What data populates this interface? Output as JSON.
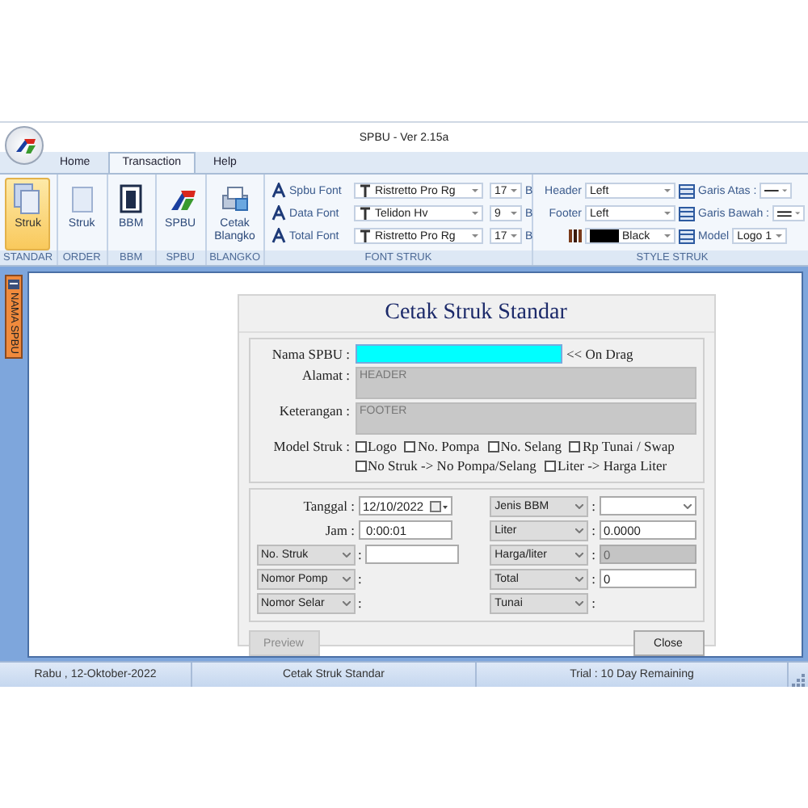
{
  "window": {
    "title": "SPBU - Ver 2.15a"
  },
  "tabs": [
    {
      "label": "Home",
      "selected": false
    },
    {
      "label": "Transaction",
      "selected": true
    },
    {
      "label": "Help",
      "selected": false
    }
  ],
  "ribbon": {
    "groups": [
      {
        "label": "STANDAR",
        "button": {
          "label": "Struk",
          "selected": true
        }
      },
      {
        "label": "ORDER",
        "button": {
          "label": "Struk",
          "selected": false
        }
      },
      {
        "label": "BBM",
        "button": {
          "label": "BBM",
          "selected": false
        }
      },
      {
        "label": "SPBU",
        "button": {
          "label": "SPBU",
          "selected": false
        }
      },
      {
        "label": "BLANGKO",
        "button": {
          "label": "Cetak Blangko",
          "selected": false
        }
      }
    ],
    "font_struk": {
      "label": "FONT STRUK",
      "rows": [
        {
          "label": "Spbu Font",
          "font": "Ristretto Pro Rg",
          "size": "17",
          "style": "B"
        },
        {
          "label": "Data Font",
          "font": "Telidon Hv",
          "size": "9",
          "style": "B"
        },
        {
          "label": "Total Font",
          "font": "Ristretto Pro Rg",
          "size": "17",
          "style": "B"
        }
      ]
    },
    "style_struk": {
      "label": "STYLE STRUK",
      "rows": [
        {
          "label": "Header",
          "value": "Left",
          "option": "Garis Atas :"
        },
        {
          "label": "Footer",
          "value": "Left",
          "option": "Garis Bawah :"
        },
        {
          "value": "Black",
          "color": "#000000",
          "option": "Model",
          "option_value": "Logo 1"
        }
      ]
    }
  },
  "side_tab": {
    "label": "NAMA SPBU"
  },
  "dialog": {
    "title": "Cetak Struk Standar",
    "nama_spbu": {
      "label": "Nama SPBU :",
      "note": "<< On Drag"
    },
    "alamat": {
      "label": "Alamat :",
      "placeholder": "HEADER"
    },
    "keterangan": {
      "label": "Keterangan :",
      "placeholder": "FOOTER"
    },
    "model_struk": {
      "label": "Model Struk :",
      "options": [
        {
          "label": "Logo",
          "checked": false
        },
        {
          "label": "No. Pompa",
          "checked": false
        },
        {
          "label": "No. Selang",
          "checked": false
        },
        {
          "label": "Rp Tunai / Swap",
          "checked": false
        },
        {
          "label": "No Struk -> No Pompa/Selang",
          "checked": false
        },
        {
          "label": "Liter -> Harga Liter",
          "checked": false
        }
      ]
    },
    "left_fields": [
      {
        "kind": "date",
        "label": "Tanggal :",
        "value": "12/10/2022"
      },
      {
        "kind": "text",
        "label": "Jam :",
        "value": "0:00:01"
      },
      {
        "kind": "select_text",
        "label": "No. Struk",
        "sep": ":"
      },
      {
        "kind": "select_only",
        "label": "Nomor Pomp",
        "sep": ":"
      },
      {
        "kind": "select_only",
        "label": "Nomor Selar",
        "sep": ":"
      }
    ],
    "right_fields": [
      {
        "kind": "select_combo",
        "label": "Jenis BBM",
        "sep": ":"
      },
      {
        "kind": "select_text",
        "label": "Liter",
        "sep": ":",
        "value": "0.0000",
        "disabled": false
      },
      {
        "kind": "select_text",
        "label": "Harga/liter",
        "sep": ":",
        "value": "0",
        "disabled": true
      },
      {
        "kind": "select_text",
        "label": "Total",
        "sep": ":",
        "value": "0",
        "disabled": false
      },
      {
        "kind": "select_only",
        "label": "Tunai",
        "sep": ":"
      }
    ],
    "buttons": [
      {
        "label": "Preview",
        "disabled": true
      },
      {
        "label": "Close",
        "disabled": false
      }
    ]
  },
  "status_bar": [
    "Rabu , 12-Oktober-2022",
    "Cetak Struk Standar",
    "Trial : 10 Day Remaining"
  ]
}
